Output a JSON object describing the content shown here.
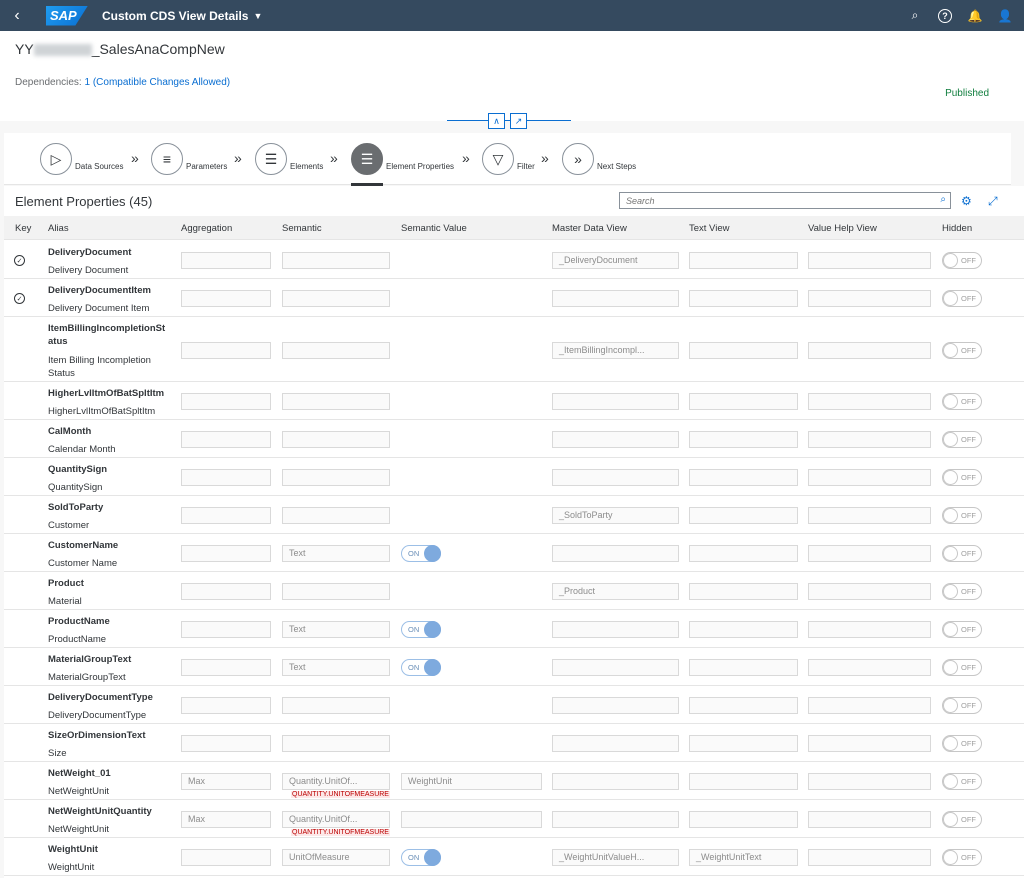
{
  "shell": {
    "logo": "SAP",
    "title": "Custom CDS View Details",
    "icons": [
      "search-icon",
      "help-icon",
      "bell-icon",
      "user-icon"
    ]
  },
  "header": {
    "title_prefix": "YY",
    "title_suffix": "_SalesAnaCompNew",
    "dependencies_label": "Dependencies:",
    "dependencies_link": "1 (Compatible Changes Allowed)",
    "status": "Published",
    "status_color": "#107e3e"
  },
  "wizard": {
    "steps": [
      {
        "label": "Data Sources"
      },
      {
        "label": "Parameters"
      },
      {
        "label": "Elements"
      },
      {
        "label": "Element Properties",
        "active": true
      },
      {
        "label": "Filter"
      },
      {
        "label": "Next Steps"
      }
    ]
  },
  "table": {
    "title": "Element Properties (45)",
    "search_placeholder": "Search",
    "columns": [
      "Key",
      "Alias",
      "Aggregation",
      "Semantic",
      "Semantic Value",
      "Master Data View",
      "Text View",
      "Value Help View",
      "Hidden"
    ],
    "rows": [
      {
        "key": true,
        "name": "DeliveryDocument",
        "desc": "Delivery Document",
        "aggregation": "",
        "semantic": "",
        "semantic_value": null,
        "master": "_DeliveryDocument",
        "text_view": "",
        "value_help": "",
        "hidden": "OFF"
      },
      {
        "key": true,
        "name": "DeliveryDocumentItem",
        "desc": "Delivery Document Item",
        "aggregation": "",
        "semantic": "",
        "semantic_value": null,
        "master": "",
        "text_view": "",
        "value_help": "",
        "hidden": "OFF"
      },
      {
        "key": false,
        "name": "ItemBillingIncompletionSt atus",
        "desc": "Item Billing Incompletion Status",
        "aggregation": "",
        "semantic": "",
        "semantic_value": null,
        "master": "_ItemBillingIncompl...",
        "text_view": "",
        "value_help": "",
        "hidden": "OFF"
      },
      {
        "key": false,
        "name": "HigherLvlItmOfBatSpltItm",
        "desc": "HigherLvlItmOfBatSpltItm",
        "aggregation": "",
        "semantic": "",
        "semantic_value": null,
        "master": "",
        "text_view": "",
        "value_help": "",
        "hidden": "OFF"
      },
      {
        "key": false,
        "name": "CalMonth",
        "desc": "Calendar Month",
        "aggregation": "",
        "semantic": "",
        "semantic_value": null,
        "master": "",
        "text_view": "",
        "value_help": "",
        "hidden": "OFF"
      },
      {
        "key": false,
        "name": "QuantitySign",
        "desc": "QuantitySign",
        "aggregation": "",
        "semantic": "",
        "semantic_value": null,
        "master": "",
        "text_view": "",
        "value_help": "",
        "hidden": "OFF"
      },
      {
        "key": false,
        "name": "SoldToParty",
        "desc": "Customer",
        "aggregation": "",
        "semantic": "",
        "semantic_value": null,
        "master": "_SoldToParty",
        "text_view": "",
        "value_help": "",
        "hidden": "OFF"
      },
      {
        "key": false,
        "name": "CustomerName",
        "desc": "Customer Name",
        "aggregation": "",
        "semantic": "Text",
        "semantic_value": "ON",
        "master": "",
        "text_view": "",
        "value_help": "",
        "hidden": "OFF"
      },
      {
        "key": false,
        "name": "Product",
        "desc": "Material",
        "aggregation": "",
        "semantic": "",
        "semantic_value": null,
        "master": "_Product",
        "text_view": "",
        "value_help": "",
        "hidden": "OFF"
      },
      {
        "key": false,
        "name": "ProductName",
        "desc": "ProductName",
        "aggregation": "",
        "semantic": "Text",
        "semantic_value": "ON",
        "master": "",
        "text_view": "",
        "value_help": "",
        "hidden": "OFF"
      },
      {
        "key": false,
        "name": "MaterialGroupText",
        "desc": "MaterialGroupText",
        "aggregation": "",
        "semantic": "Text",
        "semantic_value": "ON",
        "master": "",
        "text_view": "",
        "value_help": "",
        "hidden": "OFF"
      },
      {
        "key": false,
        "name": "DeliveryDocumentType",
        "desc": "DeliveryDocumentType",
        "aggregation": "",
        "semantic": "",
        "semantic_value": null,
        "master": "",
        "text_view": "",
        "value_help": "",
        "hidden": "OFF"
      },
      {
        "key": false,
        "name": "SizeOrDimensionText",
        "desc": "Size",
        "aggregation": "",
        "semantic": "",
        "semantic_value": null,
        "master": "",
        "text_view": "",
        "value_help": "",
        "hidden": "OFF"
      },
      {
        "key": false,
        "name": "NetWeight_01",
        "desc": "NetWeightUnit",
        "aggregation": "Max",
        "semantic": "Quantity.UnitOf...",
        "semantic_value": "WeightUnit",
        "master": "",
        "text_view": "",
        "value_help": "",
        "hidden": "OFF",
        "annotation": "QUANTITY.UNITOFMEASURE"
      },
      {
        "key": false,
        "name": "NetWeightUnitQuantity",
        "desc": "NetWeightUnit",
        "aggregation": "Max",
        "semantic": "Quantity.UnitOf...",
        "semantic_value": "",
        "master": "",
        "text_view": "",
        "value_help": "",
        "hidden": "OFF",
        "annotation": "QUANTITY.UNITOFMEASURE"
      },
      {
        "key": false,
        "name": "WeightUnit",
        "desc": "WeightUnit",
        "aggregation": "",
        "semantic": "UnitOfMeasure",
        "semantic_value": "ON",
        "master": "_WeightUnitValueH...",
        "text_view": "_WeightUnitText",
        "value_help": "",
        "hidden": "OFF"
      }
    ]
  }
}
